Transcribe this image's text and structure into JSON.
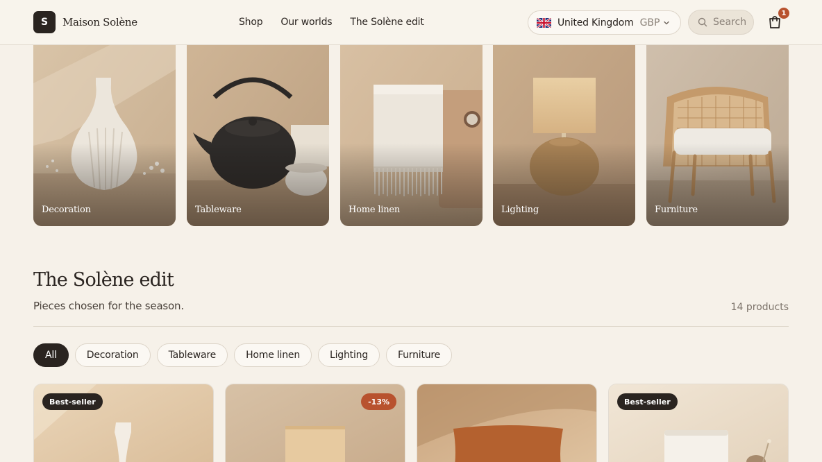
{
  "header": {
    "logo_letter": "S",
    "brand": "Maison Solène",
    "nav": [
      "Shop",
      "Our worlds",
      "The Solène edit"
    ],
    "country": {
      "name": "United Kingdom",
      "currency": "GBP",
      "flag": "uk-flag-icon"
    },
    "search_placeholder": "Search",
    "cart_count": "1"
  },
  "categories": [
    {
      "label": "Decoration"
    },
    {
      "label": "Tableware"
    },
    {
      "label": "Home linen"
    },
    {
      "label": "Lighting"
    },
    {
      "label": "Furniture"
    }
  ],
  "section": {
    "title": "The Solène edit",
    "subtitle": "Pieces chosen for the season.",
    "count": "14 products"
  },
  "filters": [
    "All",
    "Decoration",
    "Tableware",
    "Home linen",
    "Lighting",
    "Furniture"
  ],
  "products": [
    {
      "badge": "Best-seller"
    },
    {
      "badge": "-13%"
    },
    {
      "badge": ""
    },
    {
      "badge": "Best-seller"
    }
  ],
  "colors": {
    "background": "#f6f1e9",
    "ink": "#2a2420",
    "accent": "#b8522e"
  }
}
